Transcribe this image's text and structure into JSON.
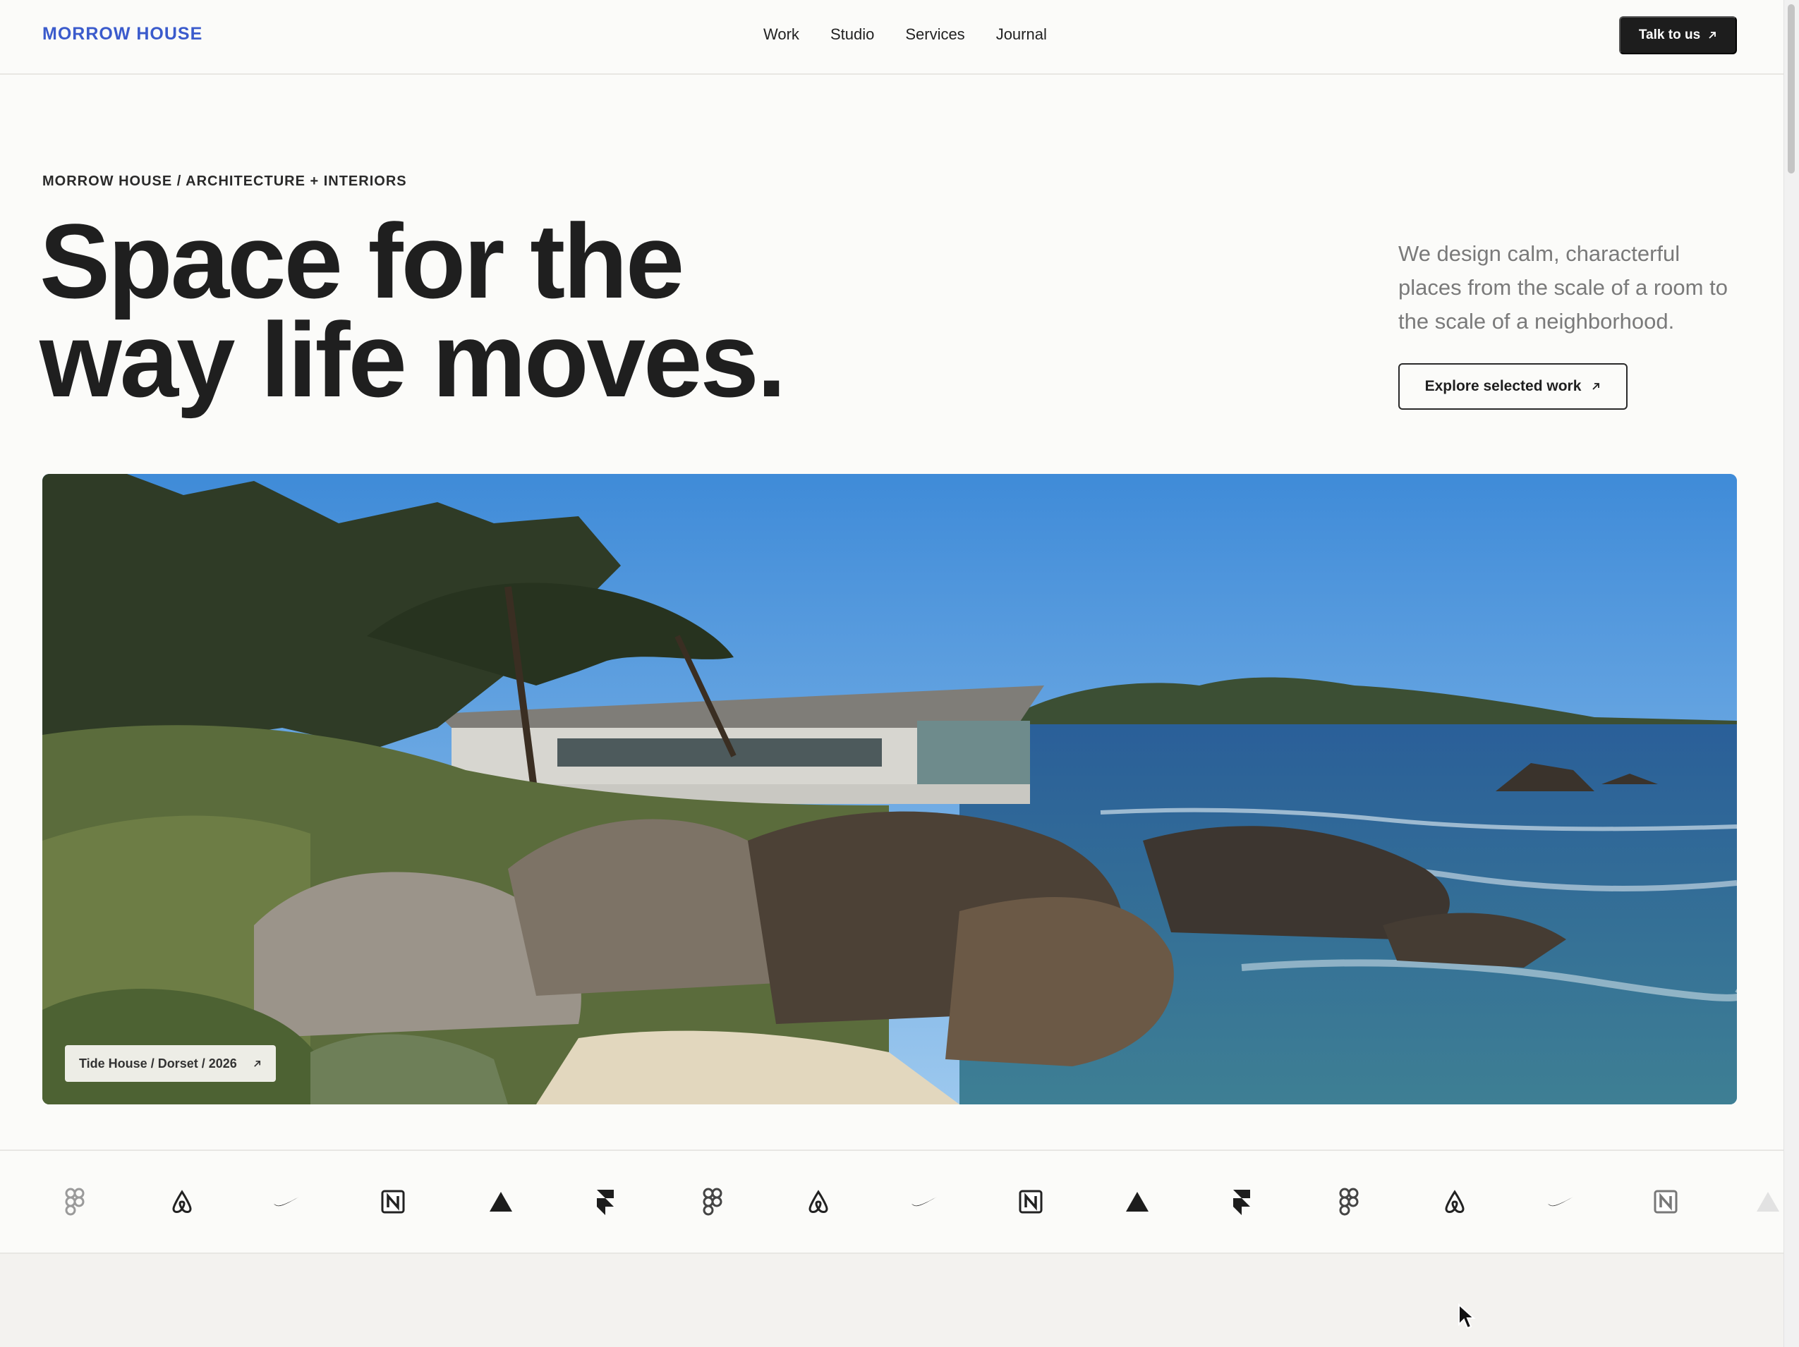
{
  "header": {
    "brand": "MORROW HOUSE",
    "nav": [
      "Work",
      "Studio",
      "Services",
      "Journal"
    ],
    "cta_label": "Talk to us",
    "cta_icon": "arrow-up-right-icon"
  },
  "hero": {
    "eyebrow": "MORROW HOUSE / ARCHITECTURE + INTERIORS",
    "headline_line1": "Space for the",
    "headline_line2": "way life moves.",
    "intro": "We design calm, characterful places from the scale of a room to the scale of a neighborhood.",
    "button_label": "Explore selected work",
    "button_icon": "arrow-up-right-icon"
  },
  "feature": {
    "caption": "Tide House / Dorset / 2026",
    "caption_icon": "arrow-up-right-icon"
  },
  "logos": [
    "figma-icon",
    "airbnb-icon",
    "nike-swoosh-icon",
    "notion-icon",
    "vercel-triangle-icon",
    "framer-icon",
    "figma-icon",
    "airbnb-icon",
    "nike-swoosh-icon",
    "notion-icon",
    "vercel-triangle-icon",
    "framer-icon",
    "figma-icon",
    "airbnb-icon",
    "nike-swoosh-icon",
    "notion-icon",
    "vercel-triangle-icon"
  ],
  "colors": {
    "brand": "#3b5bcc",
    "ink": "#1f1f1f",
    "muted": "#7a7a7a",
    "background": "#fbfbf9"
  }
}
